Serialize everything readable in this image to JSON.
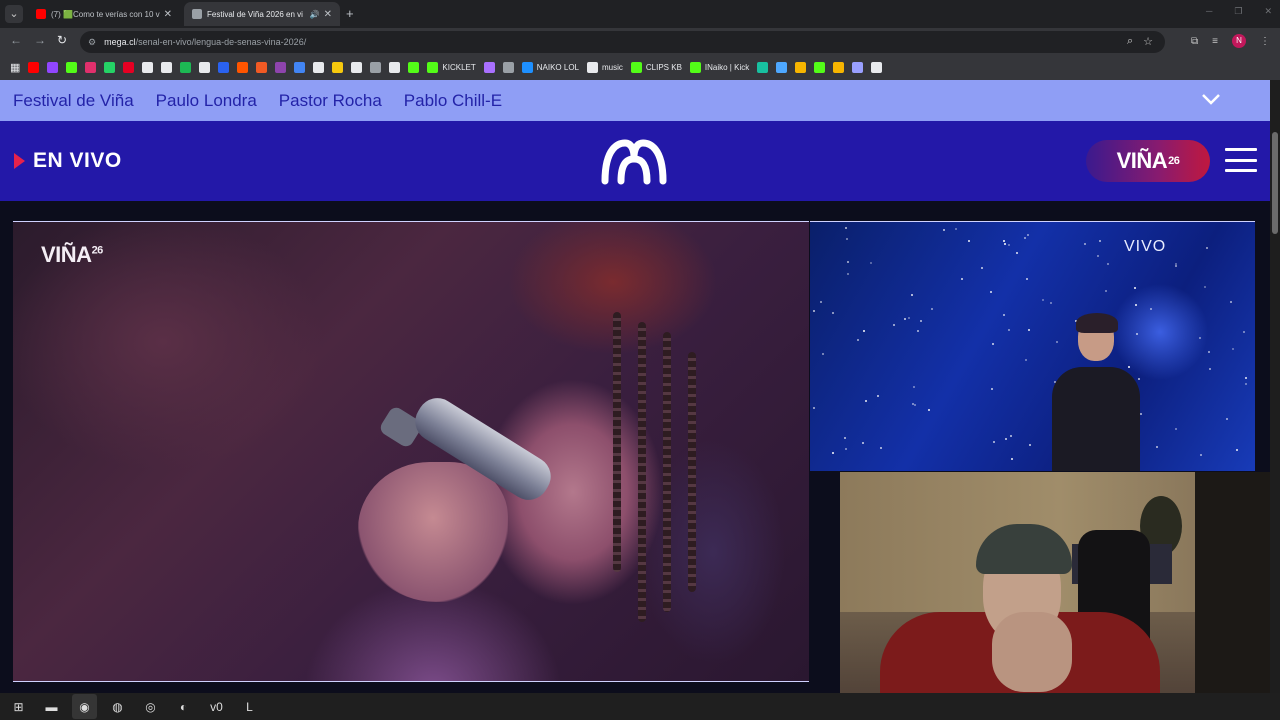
{
  "browser": {
    "tabs": [
      {
        "label": "(7) 🟩Como te verías con 10 ve",
        "favicon_color": "#ff0000"
      },
      {
        "label": "Festival de Viña 2026 en vi",
        "favicon_color": "#9aa0a6"
      }
    ],
    "url_host": "mega.cl",
    "url_path": "/senal-en-vivo/lengua-de-senas-vina-2026/",
    "profile_initial": "N"
  },
  "bookmarks": [
    {
      "name": "youtube-bookmark",
      "label": "",
      "color": "#ff0000"
    },
    {
      "name": "twitch-bookmark",
      "label": "",
      "color": "#9146ff"
    },
    {
      "name": "kick-bookmark",
      "label": "",
      "color": "#53fc18"
    },
    {
      "name": "instagram-bookmark",
      "label": "",
      "color": "#e1306c"
    },
    {
      "name": "whatsapp-bookmark",
      "label": "",
      "color": "#25d366"
    },
    {
      "name": "pinterest-bookmark",
      "label": "",
      "color": "#e60023"
    },
    {
      "name": "x-bookmark",
      "label": "",
      "color": "#e8eaed"
    },
    {
      "name": "tiktok-bookmark",
      "label": "",
      "color": "#e8eaed"
    },
    {
      "name": "spotify-bookmark",
      "label": "",
      "color": "#1db954"
    },
    {
      "name": "s-bookmark",
      "label": "",
      "color": "#e8eaed"
    },
    {
      "name": "blue-bookmark",
      "label": "",
      "color": "#2a62f0"
    },
    {
      "name": "soundcloud-bookmark",
      "label": "",
      "color": "#ff5500"
    },
    {
      "name": "orange-bookmark",
      "label": "",
      "color": "#f15a24"
    },
    {
      "name": "purple-bookmark",
      "label": "",
      "color": "#8e44ad"
    },
    {
      "name": "search-bookmark",
      "label": "",
      "color": "#4285f4"
    },
    {
      "name": "circle-bookmark",
      "label": "",
      "color": "#e8eaed"
    },
    {
      "name": "yellow-bookmark",
      "label": "",
      "color": "#f6c90e"
    },
    {
      "name": "cat-bookmark",
      "label": "",
      "color": "#e8eaed"
    },
    {
      "name": "image-bookmark",
      "label": "",
      "color": "#9aa0a6"
    },
    {
      "name": "diamond-bookmark",
      "label": "",
      "color": "#e8eaed"
    },
    {
      "name": "kicklet-green-bookmark",
      "label": "",
      "color": "#53fc18"
    },
    {
      "name": "kicklet-bookmark",
      "label": "KICKLET",
      "color": "#53fc18"
    },
    {
      "name": "violet-bookmark",
      "label": "",
      "color": "#a970ff"
    },
    {
      "name": "shield-bookmark",
      "label": "",
      "color": "#9aa0a6"
    },
    {
      "name": "naiko-lol-bookmark",
      "label": "NAIKO LOL",
      "color": "#1e90ff"
    },
    {
      "name": "music-bookmark",
      "label": "music",
      "color": "#e8eaed"
    },
    {
      "name": "clips-kb-bookmark",
      "label": "CLIPS KB",
      "color": "#53fc18"
    },
    {
      "name": "naiko-kick-bookmark",
      "label": "INaiko | Kick",
      "color": "#53fc18"
    },
    {
      "name": "teal-bookmark",
      "label": "",
      "color": "#18c0a0"
    },
    {
      "name": "stats-bookmark",
      "label": "",
      "color": "#4ea8ff"
    },
    {
      "name": "r-bookmark",
      "label": "",
      "color": "#f7b500"
    },
    {
      "name": "green-box-bookmark",
      "label": "",
      "color": "#53fc18"
    },
    {
      "name": "u-bookmark",
      "label": "",
      "color": "#f7b500"
    },
    {
      "name": "swirl-bookmark",
      "label": "",
      "color": "#9aa0ff"
    },
    {
      "name": "generic-bookmark",
      "label": "",
      "color": "#e8eaed"
    }
  ],
  "site": {
    "categories": [
      "Festival de Viña",
      "Paulo Londra",
      "Pastor Rocha",
      "Pablo Chill-E"
    ],
    "live_label": "EN VIVO",
    "vina_badge": "VIÑA",
    "vina_badge_year": "26",
    "watermark": "VIÑA",
    "watermark_year": "26",
    "sign_overlay": "VIVO",
    "colors": {
      "nav_bg": "#8f9ef5",
      "header_bg": "#2318a8",
      "live_accent": "#e6224b"
    }
  },
  "taskbar": [
    {
      "name": "start-button",
      "glyph": "⊞"
    },
    {
      "name": "file-explorer-button",
      "glyph": "▬"
    },
    {
      "name": "chrome-button",
      "glyph": "◉"
    },
    {
      "name": "obs-button",
      "glyph": "◍"
    },
    {
      "name": "spotify-button",
      "glyph": "◎"
    },
    {
      "name": "discord-button",
      "glyph": "◐"
    },
    {
      "name": "app-v0-button",
      "glyph": "v0"
    },
    {
      "name": "league-button",
      "glyph": "L"
    }
  ]
}
